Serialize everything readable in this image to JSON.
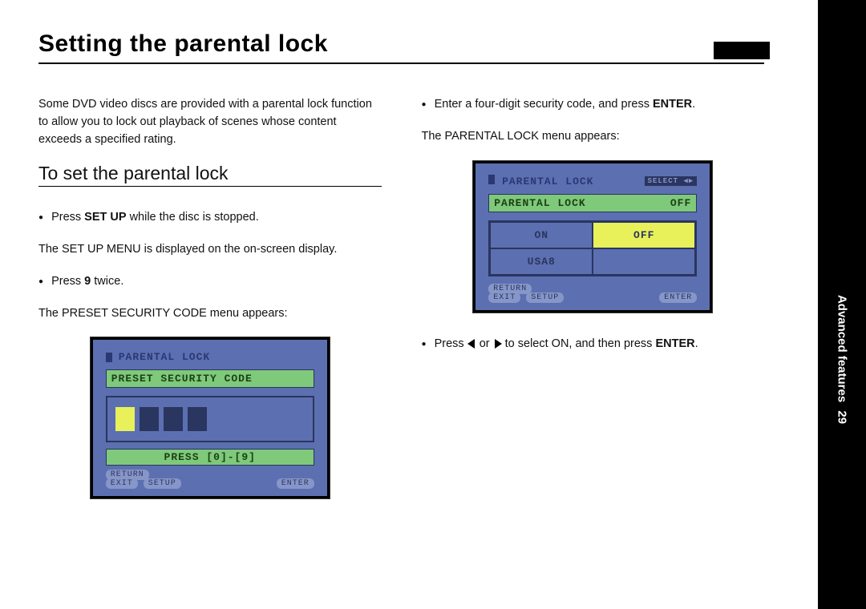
{
  "title": "Setting the parental lock",
  "intro": "Some DVD video discs are provided with a parental lock function to allow you to lock out playback of scenes whose content exceeds a specified rating.",
  "section_heading": "To set the parental lock",
  "left": {
    "step1_pre": "Press ",
    "step1_bold": "SET UP",
    "step1_post": " while the disc is stopped.",
    "step1_result": "The SET UP MENU is displayed on the on-screen display.",
    "step2_pre": "Press ",
    "step2_bold": "9",
    "step2_post": " twice.",
    "step2_result": "The PRESET SECURITY CODE menu appears:"
  },
  "right": {
    "step3_pre": "Enter a four-digit security code, and press ",
    "step3_bold": "ENTER",
    "step3_post": ".",
    "step3_result": "The PARENTAL LOCK menu appears:",
    "step4_pre": "Press ",
    "step4_mid": " or ",
    "step4_post": " to select ON, and then press ",
    "step4_bold": "ENTER",
    "step4_end": "."
  },
  "osd1": {
    "title": "PARENTAL LOCK",
    "bar": "PRESET SECURITY CODE",
    "hint": "PRESS [0]-[9]",
    "footer_left1": "RETURN",
    "footer_left2": "EXIT",
    "footer_left3": "SETUP",
    "footer_right": "ENTER"
  },
  "osd2": {
    "title": "PARENTAL LOCK",
    "select": "SELECT",
    "bar_label": "PARENTAL LOCK",
    "bar_value": "OFF",
    "opt_on": "ON",
    "opt_off": "OFF",
    "opt_usa8": "USA8",
    "footer_left1": "RETURN",
    "footer_left2": "EXIT",
    "footer_left3": "SETUP",
    "footer_right": "ENTER"
  },
  "sidebar": {
    "label": "Advanced features",
    "page": "29"
  }
}
